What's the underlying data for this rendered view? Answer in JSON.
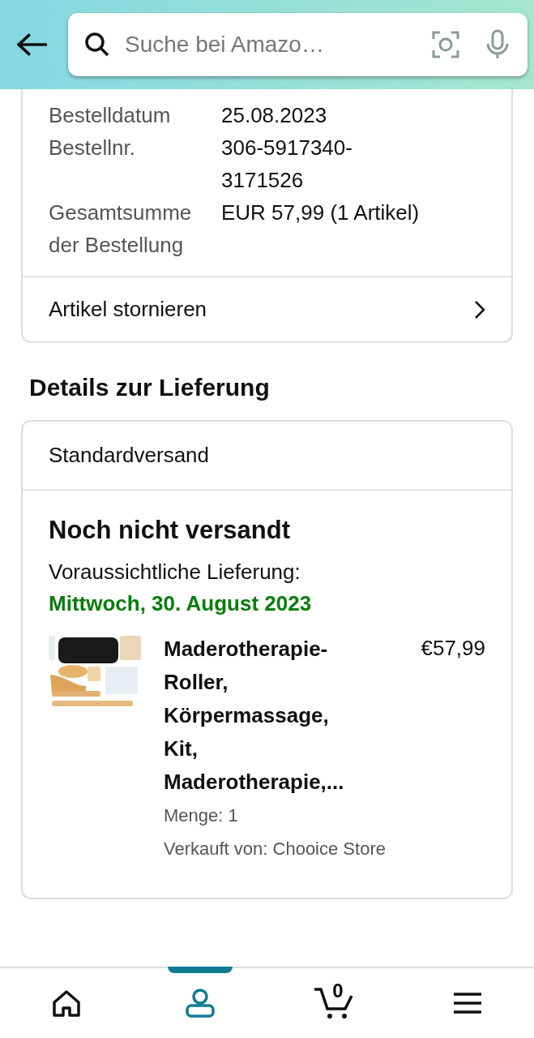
{
  "header": {
    "search": {
      "placeholder": "Suche bei Amazo…"
    }
  },
  "order_summary": {
    "rows": [
      {
        "label": "Bestelldatum",
        "value": "25.08.2023"
      },
      {
        "label": "Bestellnr.",
        "value": "306-5917340-3171526"
      },
      {
        "label": "Gesamtsumme der Bestellung",
        "value": "EUR 57,99 (1 Artikel)"
      }
    ],
    "action": "Artikel stornieren"
  },
  "delivery": {
    "heading": "Details zur Lieferung",
    "shipping_method": "Standardversand",
    "status": "Noch nicht versandt",
    "estimate_label": "Voraussichtliche Lieferung:",
    "estimate_date": "Mittwoch, 30. August 2023",
    "item": {
      "title": "Maderotherapie-Roller, Körpermassage, Kit, Maderotherapie,...",
      "price": "€57,99",
      "quantity": "Menge: 1",
      "seller": "Verkauft von: Chooice Store"
    }
  },
  "bottom_nav": [
    {
      "kind": "home",
      "selected": false
    },
    {
      "kind": "account",
      "selected": true
    },
    {
      "kind": "cart",
      "selected": false,
      "count": "0"
    },
    {
      "kind": "menu",
      "selected": false
    }
  ]
}
